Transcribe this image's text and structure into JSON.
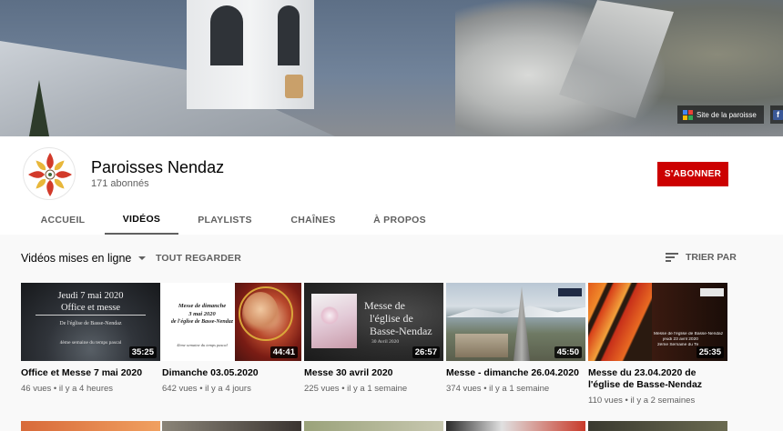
{
  "banner": {
    "link_label": "Site de la paroisse",
    "facebook_glyph": "f",
    "brand_colors": [
      "#4285f4",
      "#ea4335",
      "#fbbc05",
      "#34a853"
    ]
  },
  "channel": {
    "name": "Paroisses Nendaz",
    "subscribers": "171 abonnés",
    "subscribe_label": "S'ABONNER",
    "subscribe_color": "#cc0000",
    "avatar_icon": "parish-emblem-icon"
  },
  "tabs": [
    {
      "label": "ACCUEIL",
      "active": false
    },
    {
      "label": "VIDÉOS",
      "active": true
    },
    {
      "label": "PLAYLISTS",
      "active": false
    },
    {
      "label": "CHAÎNES",
      "active": false
    },
    {
      "label": "À PROPOS",
      "active": false
    }
  ],
  "section": {
    "title": "Vidéos mises en ligne",
    "play_all": "TOUT REGARDER",
    "sort": "TRIER PAR"
  },
  "videos": [
    {
      "title": "Office et Messe 7 mai 2020",
      "meta": "46 vues • il y a 4 heures",
      "duration": "35:25",
      "thumb_lines": [
        "Jeudi 7 mai 2020",
        "Office et messe",
        "De l'église de Basse-Nendaz",
        "4ème semaine du temps pascal"
      ]
    },
    {
      "title": "Dimanche 03.05.2020",
      "meta": "642 vues • il y a 4 jours",
      "duration": "44:41",
      "thumb_lines": [
        "Messe de dimanche",
        "3 mai 2020",
        "de l'église de Basse-Nendaz",
        "4ème semaine du temps pascal"
      ]
    },
    {
      "title": "Messe 30 avril 2020",
      "meta": "225 vues • il y a 1 semaine",
      "duration": "26:57",
      "thumb_lines": [
        "Messe de",
        "l'église de",
        "Basse-Nendaz",
        "30 Avril 2020"
      ]
    },
    {
      "title": "Messe - dimanche 26.04.2020",
      "meta": "374 vues • il y a 1 semaine",
      "duration": "45:50",
      "thumb_lines": []
    },
    {
      "title": "Messe du 23.04.2020 de l'église de Basse-Nendaz",
      "meta": "110 vues • il y a 2 semaines",
      "duration": "25:35",
      "thumb_lines": [
        "Messe de l'église de Basse-Nendaz",
        "jeudi 23 avril 2020",
        "2ème Semaine du Te"
      ]
    }
  ]
}
